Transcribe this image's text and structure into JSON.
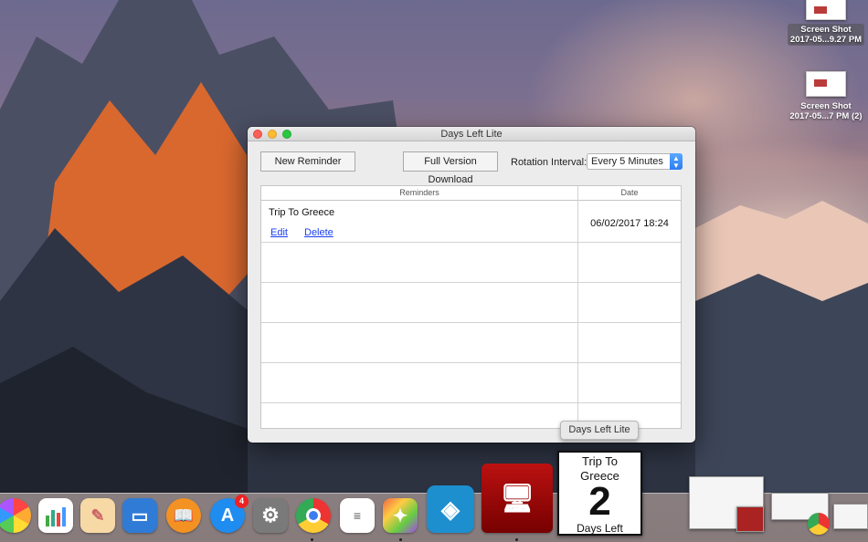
{
  "desktop": {
    "files": [
      {
        "name_line1": "Screen Shot",
        "name_line2": "2017-05...9.27 PM"
      },
      {
        "name_line1": "Screen Shot",
        "name_line2": "2017-05...7 PM (2)"
      }
    ]
  },
  "window": {
    "title": "Days Left Lite",
    "toolbar": {
      "new_reminder": "New Reminder",
      "full_version": "Full Version Download",
      "rotation_label": "Rotation Interval:",
      "rotation_value": "Every 5 Minutes"
    },
    "table": {
      "headers": {
        "reminders": "Reminders",
        "date": "Date"
      },
      "rows": [
        {
          "title": "Trip To Greece",
          "edit": "Edit",
          "delete": "Delete",
          "date": "06/02/2017 18:24"
        }
      ]
    }
  },
  "dock": {
    "tooltip": "Days Left Lite",
    "app_store_badge": "4",
    "widget": {
      "line1": "Trip To",
      "line2": "Greece",
      "number": "2",
      "footer": "Days Left"
    }
  }
}
